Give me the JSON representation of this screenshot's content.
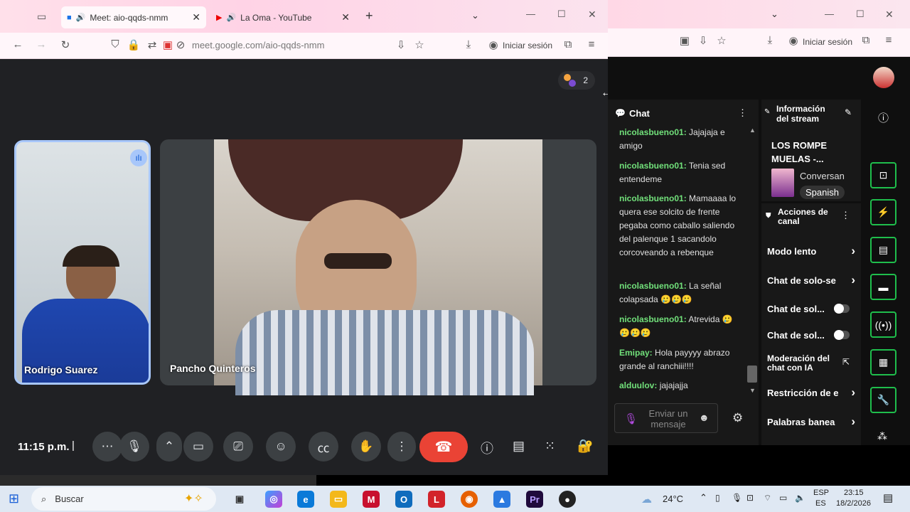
{
  "left_browser": {
    "tabs": [
      {
        "label": "Meet: aio-qqds-nmm"
      },
      {
        "label": "La Oma - YouTube"
      }
    ],
    "url": "meet.google.com/aio-qqds-nmm",
    "signin": "Iniciar sesión"
  },
  "meet": {
    "participants_count": "2",
    "tiles": [
      {
        "name": "Rodrigo Suarez"
      },
      {
        "name": "Pancho Quinteros"
      }
    ],
    "time": "11:15 p.m."
  },
  "right_browser": {
    "signin": "Iniciar sesión",
    "chat": {
      "title": "Chat",
      "messages": [
        {
          "user": "nicolasbueno01:",
          "text": "Jajajaja e amigo"
        },
        {
          "user": "nicolasbueno01:",
          "text": "Tenia sed entendeme"
        },
        {
          "user": "nicolasbueno01:",
          "text": "Mamaaaa lo quera ese solcito de frente pegaba como caballo saliendo del palenque 1 sacandolo corcoveando a rebenque"
        },
        {
          "user": "nicolasbueno01:",
          "text": "La señal colapsada 🥲🥲🥲"
        },
        {
          "user": "nicolasbueno01:",
          "text": "Atrevida 🥲🥲🥲🥲"
        },
        {
          "user": "Emipay:",
          "text": "Hola payyyy abrazo grande al ranchiii!!!!"
        },
        {
          "user": "alduulov:",
          "text": "jajajajja"
        }
      ],
      "input_placeholder": "Enviar un mensaje"
    },
    "stream_info": {
      "title": "Información del stream",
      "stream_name": "LOS ROMPE MUELAS -...",
      "category": "Conversan",
      "language": "Spanish"
    },
    "channel_actions": {
      "title": "Acciones de canal",
      "items": [
        {
          "label": "Modo lento"
        },
        {
          "label": "Chat de solo-se"
        },
        {
          "label": "Chat de sol..."
        },
        {
          "label": "Chat de sol..."
        },
        {
          "label": "Moderación del chat con IA"
        },
        {
          "label": "Restricción de e"
        },
        {
          "label": "Palabras banea"
        }
      ]
    }
  },
  "taskbar": {
    "search": "Buscar",
    "weather": "24°C",
    "lang1": "ESP",
    "lang2": "ES",
    "clock_time": "23:15",
    "clock_date": "18/2/2026"
  }
}
